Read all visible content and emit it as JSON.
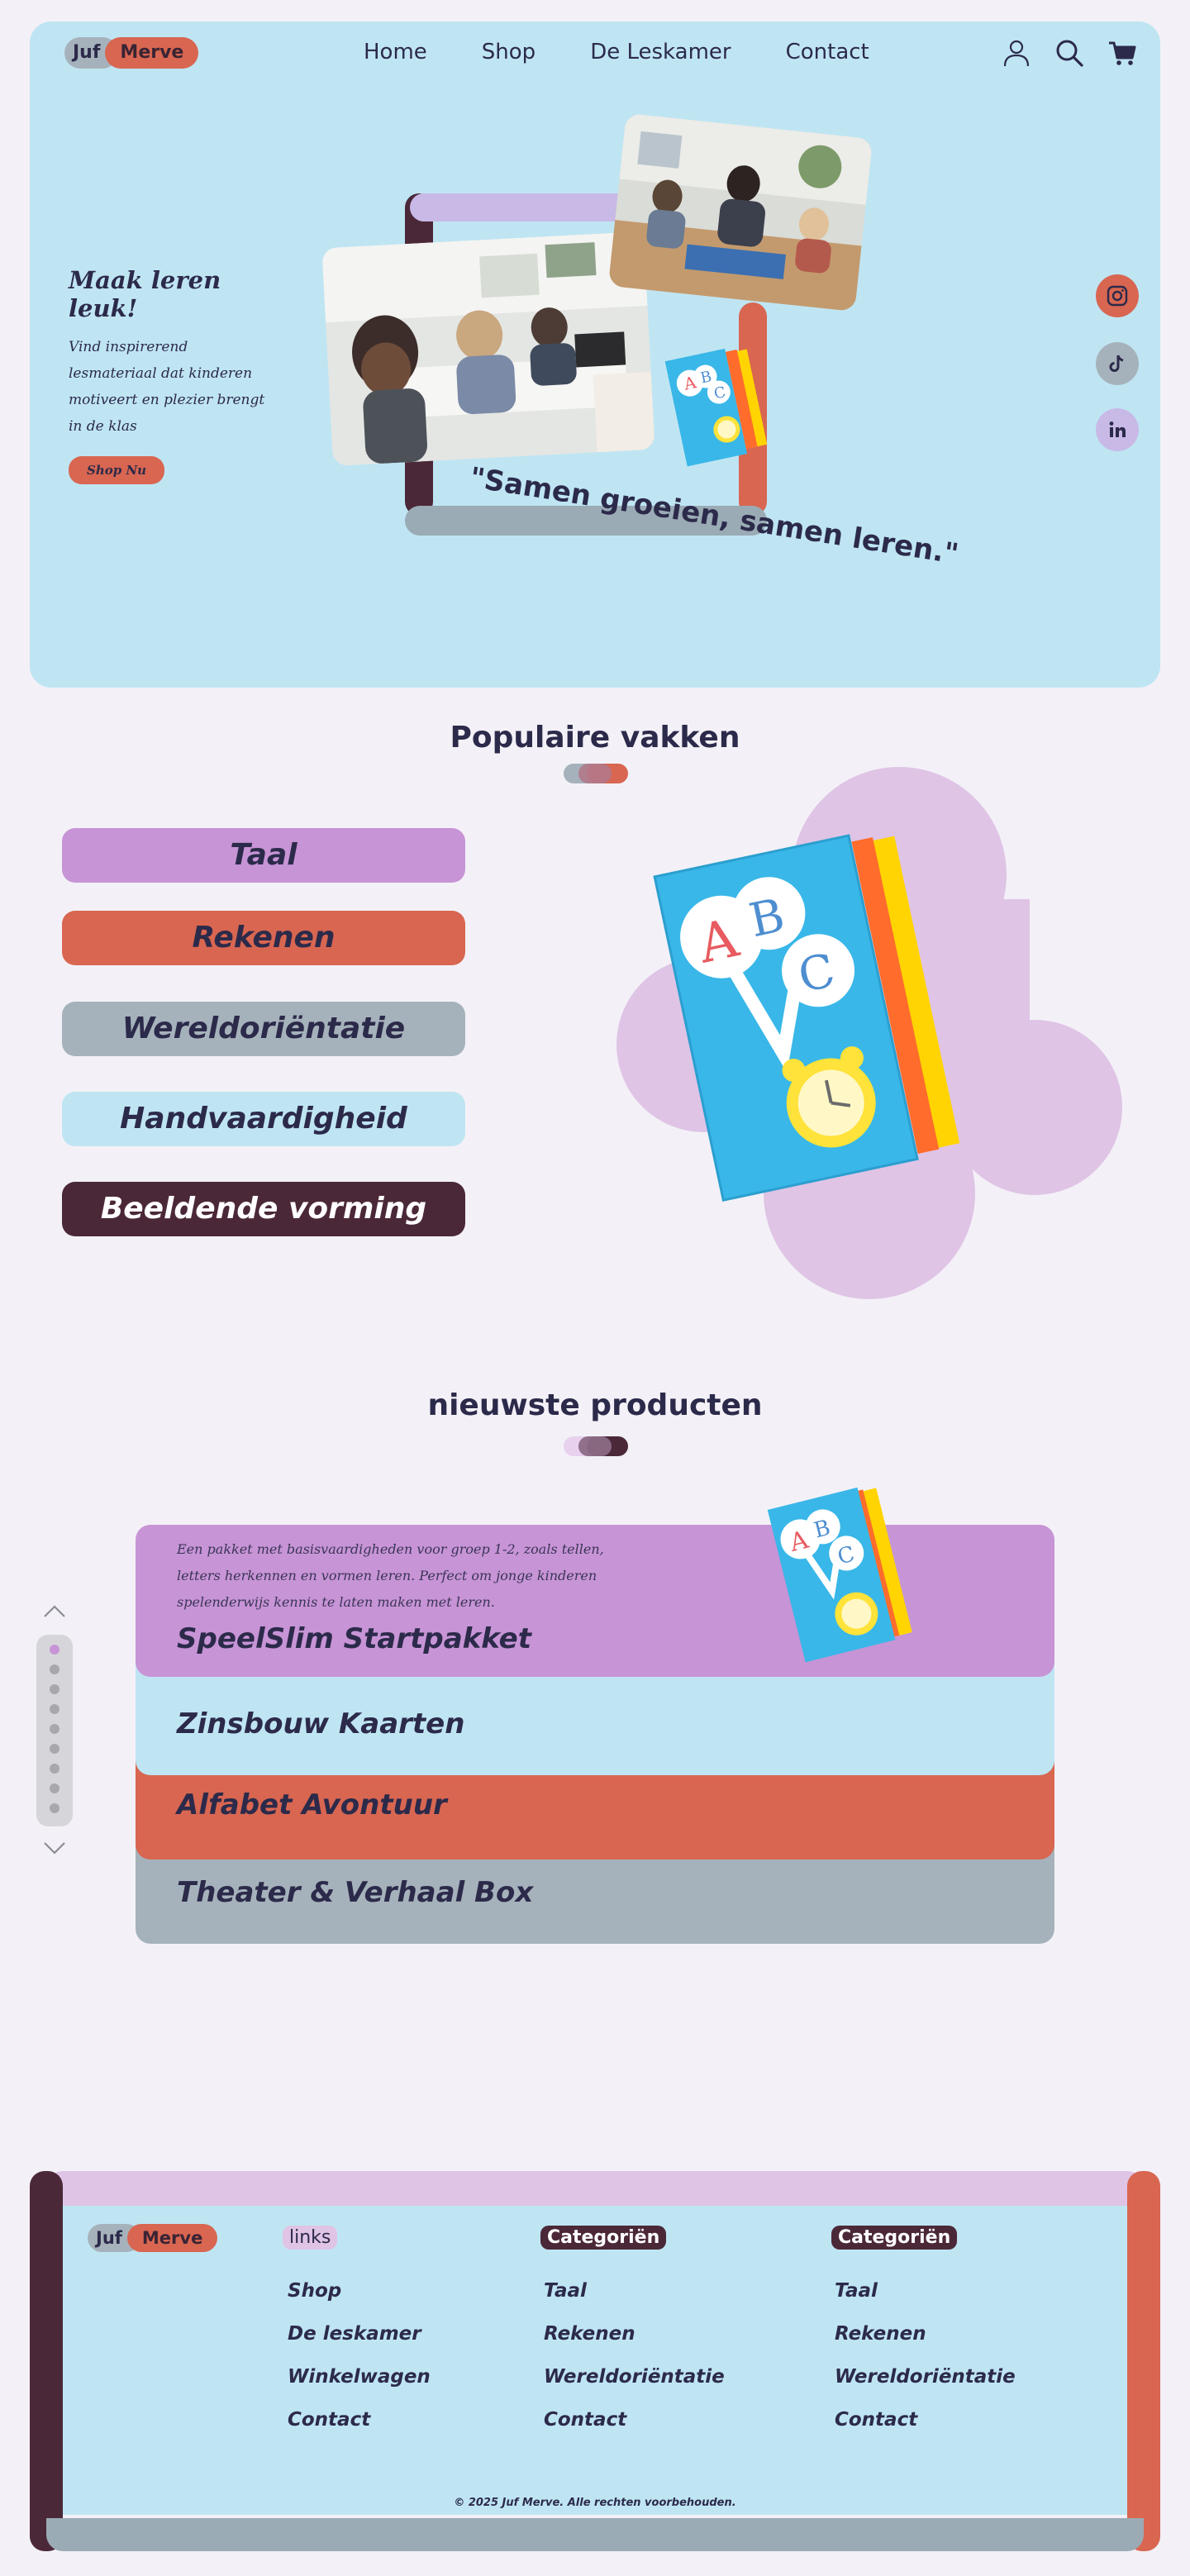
{
  "header": {
    "logo": {
      "part1": "Juf",
      "part2": "Merve"
    },
    "nav": [
      "Home",
      "Shop",
      "De Leskamer",
      "Contact"
    ],
    "icons": [
      "user-icon",
      "search-icon",
      "cart-icon"
    ]
  },
  "hero": {
    "title": "Maak leren leuk!",
    "text": "Vind inspirerend lesmateriaal dat kinderen motiveert en plezier brengt in de klas",
    "button": "Shop Nu",
    "quote": "\"Samen groeien, samen leren.\""
  },
  "social": [
    "instagram-icon",
    "tiktok-icon",
    "linkedin-icon"
  ],
  "subjects": {
    "title": "Populaire vakken",
    "items": [
      {
        "label": "Taal",
        "color": "#c794d6"
      },
      {
        "label": "Rekenen",
        "color": "#d86651"
      },
      {
        "label": "Wereldoriëntatie",
        "color": "#a6b2bb"
      },
      {
        "label": "Handvaardigheid",
        "color": "#bfe5f3"
      },
      {
        "label": "Beeldende vorming",
        "color": "#4b2838"
      }
    ]
  },
  "products": {
    "title": "nieuwste producten",
    "active_description": "Een pakket met basisvaardigheden voor groep 1-2, zoals tellen, letters herkennen en vormen leren. Perfect om jonge kinderen spelenderwijs kennis te laten maken met leren.",
    "items": [
      {
        "name": "SpeelSlim Startpakket",
        "color": "#c794d6"
      },
      {
        "name": "Zinsbouw Kaarten",
        "color": "#bfe5f3"
      },
      {
        "name": "Alfabet Avontuur",
        "color": "#d86651"
      },
      {
        "name": "Theater & Verhaal Box",
        "color": "#a6b2bb"
      }
    ],
    "pagination_dots": 9,
    "active_dot": 1
  },
  "footer": {
    "logo": {
      "part1": "Juf",
      "part2": "Merve"
    },
    "columns": [
      {
        "title": "links",
        "links": [
          "Shop",
          "De leskamer",
          "Winkelwagen",
          "Contact"
        ]
      },
      {
        "title": "Categoriën",
        "links": [
          "Taal",
          "Rekenen",
          "Wereldoriëntatie",
          "Contact"
        ]
      },
      {
        "title": "Categoriën",
        "links": [
          "Taal",
          "Rekenen",
          "Wereldoriëntatie",
          "Contact"
        ]
      }
    ],
    "copyright": "© 2025 Juf Merve. Alle rechten voorbehouden."
  },
  "colors": {
    "light_blue": "#bfe5f3",
    "lilac": "#c794d6",
    "coral": "#d86651",
    "gray": "#a6b2bb",
    "plum": "#4b2838",
    "navy_text": "#2c2a4a",
    "page_bg": "#f3f1f7"
  }
}
